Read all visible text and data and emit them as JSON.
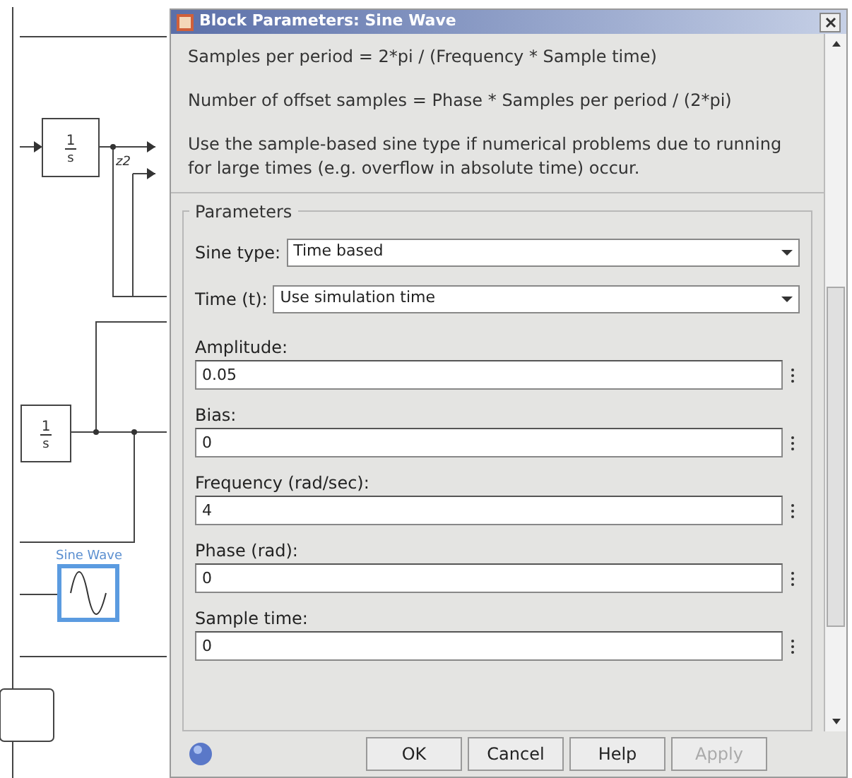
{
  "diagram": {
    "blocks": [
      {
        "kind": "integrator",
        "numerator": "1",
        "denominator": "s"
      },
      {
        "kind": "integrator",
        "numerator": "1",
        "denominator": "s"
      },
      {
        "kind": "sine",
        "label": "Sine Wave",
        "selected": true
      }
    ],
    "signal_label": "z2"
  },
  "dialog": {
    "title": "Block Parameters: Sine Wave",
    "description": [
      "Samples per period = 2*pi / (Frequency * Sample time)",
      "Number of offset samples = Phase * Samples per period / (2*pi)",
      "Use the sample-based sine type if numerical problems due to running for large times (e.g. overflow in absolute time) occur."
    ],
    "group": "Parameters",
    "params": [
      {
        "kind": "dropdown",
        "label": "Sine type:",
        "value": "Time based"
      },
      {
        "kind": "dropdown",
        "label": "Time (t):",
        "value": "Use simulation time"
      },
      {
        "kind": "edit",
        "label": "Amplitude:",
        "value": "0.05"
      },
      {
        "kind": "edit",
        "label": "Bias:",
        "value": "0"
      },
      {
        "kind": "edit",
        "label": "Frequency (rad/sec):",
        "value": "4"
      },
      {
        "kind": "edit",
        "label": "Phase (rad):",
        "value": "0"
      },
      {
        "kind": "edit",
        "label": "Sample time:",
        "value": "0"
      }
    ],
    "buttons": [
      {
        "label": "OK",
        "disabled": false
      },
      {
        "label": "Cancel",
        "disabled": false
      },
      {
        "label": "Help",
        "disabled": false
      },
      {
        "label": "Apply",
        "disabled": true
      }
    ]
  }
}
